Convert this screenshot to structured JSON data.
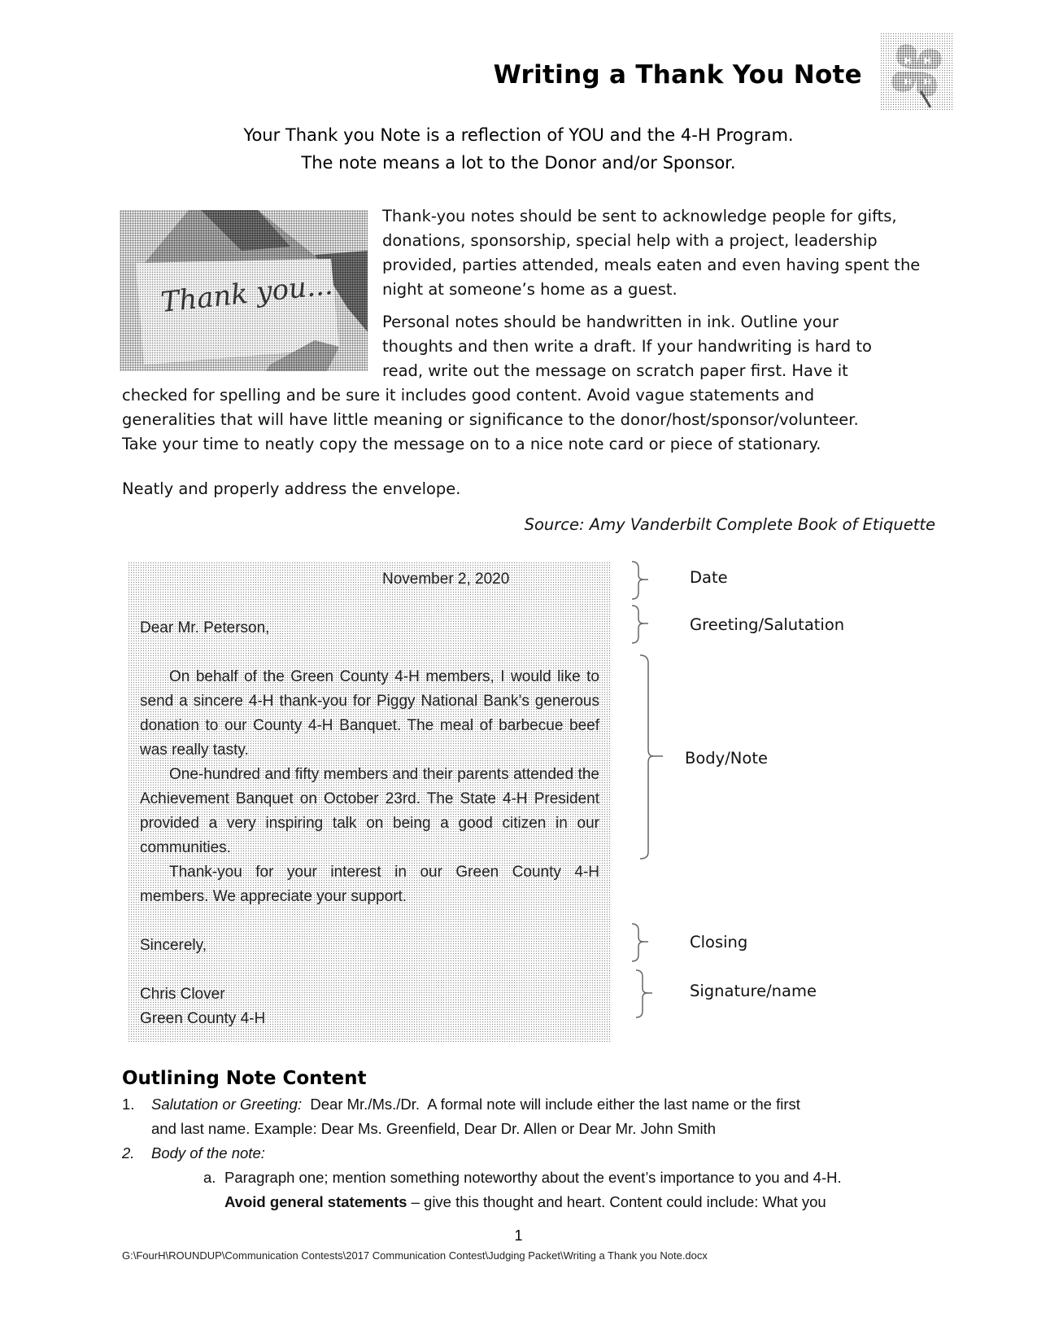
{
  "header": {
    "title": "Writing a Thank You Note",
    "logo_icon": "four-h-clover-icon"
  },
  "subtitle": {
    "line1": "Your Thank you Note is a reflection of YOU and the 4-H Program.",
    "line2": "The note means a lot to the Donor and/or Sponsor."
  },
  "image": {
    "caption_text": "Thank you..."
  },
  "intro": {
    "paragraph1_lines": [
      "Thank-you notes should be sent to acknowledge people for gifts,",
      "donations, sponsorship, special help with a project, leadership",
      "provided, parties attended, meals eaten and even having spent the",
      "night at someone’s home as a guest."
    ],
    "paragraph2_lines_narrow": [
      "Personal notes should be handwritten in ink. Outline your",
      "thoughts and then write a draft.  If your handwriting is hard to",
      "read, write out the message on scratch paper first.  Have it"
    ],
    "paragraph2_lines_wide": [
      "checked for spelling and be sure it includes good content.  Avoid vague statements and",
      "generalities that will have little meaning or significance to the donor/host/sponsor/volunteer.",
      "Take your time to neatly copy the message on to a nice note card or piece of stationary."
    ],
    "paragraph3": "Neatly and properly address the envelope.",
    "source": "Source:  Amy Vanderbilt Complete Book of Etiquette"
  },
  "sample_letter": {
    "date": "November 2, 2020",
    "greeting": "Dear Mr. Peterson,",
    "body_paragraphs": [
      "On behalf of the Green County 4-H members, I would like to send a sincere 4-H thank-you for Piggy National Bank’s generous donation to our County 4-H Banquet.  The meal of barbecue beef was really tasty.",
      "One-hundred and fifty members and their parents attended the Achievement Banquet on October 23rd. The State 4-H President provided a very inspiring talk on being a good citizen in our communities.",
      "Thank-you for your interest in our Green County 4-H members.  We appreciate your support."
    ],
    "closing": "Sincerely,",
    "signature_name": "Chris Clover",
    "signature_org": "Green County 4-H"
  },
  "annotations": {
    "date": "Date",
    "greeting": "Greeting/Salutation",
    "body": "Body/Note",
    "closing": "Closing",
    "signature": "Signature/name"
  },
  "outline": {
    "heading": "Outlining Note Content",
    "items": [
      {
        "number": "1.",
        "label": "Salutation or Greeting:",
        "text_line1": "  Dear Mr./Ms./Dr.  A formal note will include either the last name or the first",
        "text_line2": "and last name.   Example:  Dear Ms. Greenfield, Dear Dr. Allen or Dear Mr. John Smith"
      },
      {
        "number": "2.",
        "label": "Body of the note:",
        "subitems": [
          {
            "letter": "a.",
            "text_line1": "Paragraph one; mention something noteworthy about the event’s importance to you and 4-H.",
            "bold_lead": "Avoid general statements",
            "text_line2": " – give this thought and heart.  Content could include: What you"
          }
        ]
      }
    ]
  },
  "footer": {
    "page_number": "1",
    "file_path": "G:\\FourH\\ROUNDUP\\Communication Contests\\2017 Communication Contest\\Judging Packet\\Writing a Thank you Note.docx"
  }
}
